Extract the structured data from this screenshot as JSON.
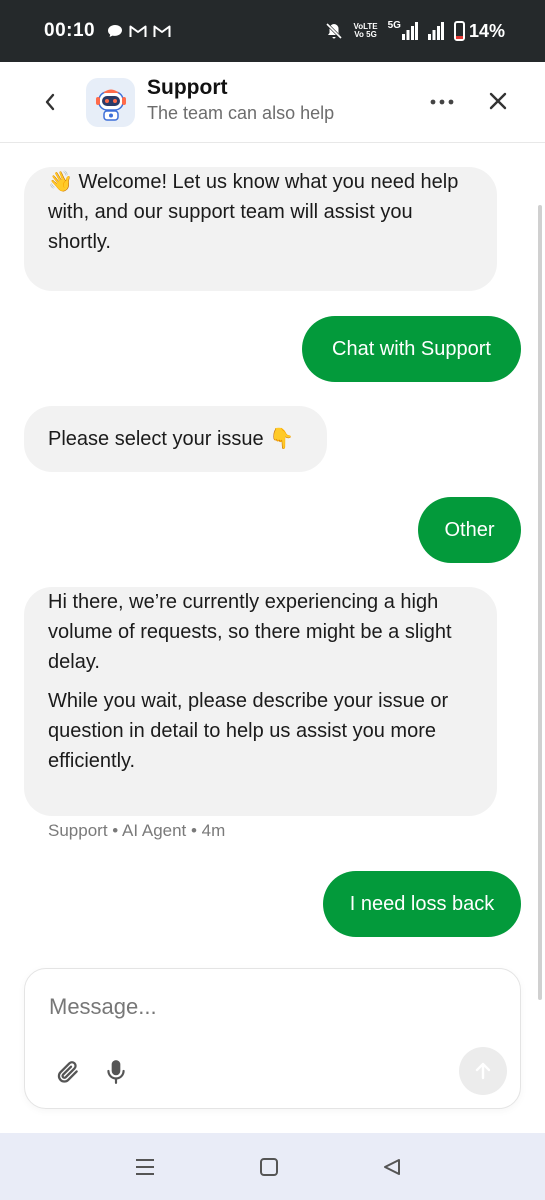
{
  "status_bar": {
    "time": "00:10",
    "notification_icons": [
      "chat-bubble-icon",
      "gmail-icon",
      "gmail-icon"
    ],
    "volte_line1": "VoLTE",
    "volte_line2": "Vo 5G",
    "network": "5G",
    "battery": "14%",
    "battery_level": 0.14,
    "battery_color": "#e53935"
  },
  "header": {
    "title": "Support",
    "subtitle": "The team can also help"
  },
  "messages": [
    {
      "sender": "agent",
      "text": "👋 Welcome! Let us know what you need help with, and our support team will assist you shortly."
    },
    {
      "sender": "user",
      "text": "Chat with Support"
    },
    {
      "sender": "agent",
      "text": "Please select your issue 👇"
    },
    {
      "sender": "user",
      "text": "Other"
    },
    {
      "sender": "agent",
      "paragraphs": [
        "Hi there, we’re currently experiencing a high volume of requests, so there might be a slight delay.",
        "While you wait, please describe your issue or question in detail to help us assist you more efficiently."
      ]
    },
    {
      "sender": "user",
      "text": "I need loss back"
    }
  ],
  "message_meta": "Support • AI Agent • 4m",
  "composer": {
    "placeholder": "Message...",
    "value": ""
  },
  "colors": {
    "accent": "#039a3b",
    "agent_bubble": "#f2f2f2",
    "status_bar": "#25292b",
    "nav_bar": "#e9ecf7"
  }
}
